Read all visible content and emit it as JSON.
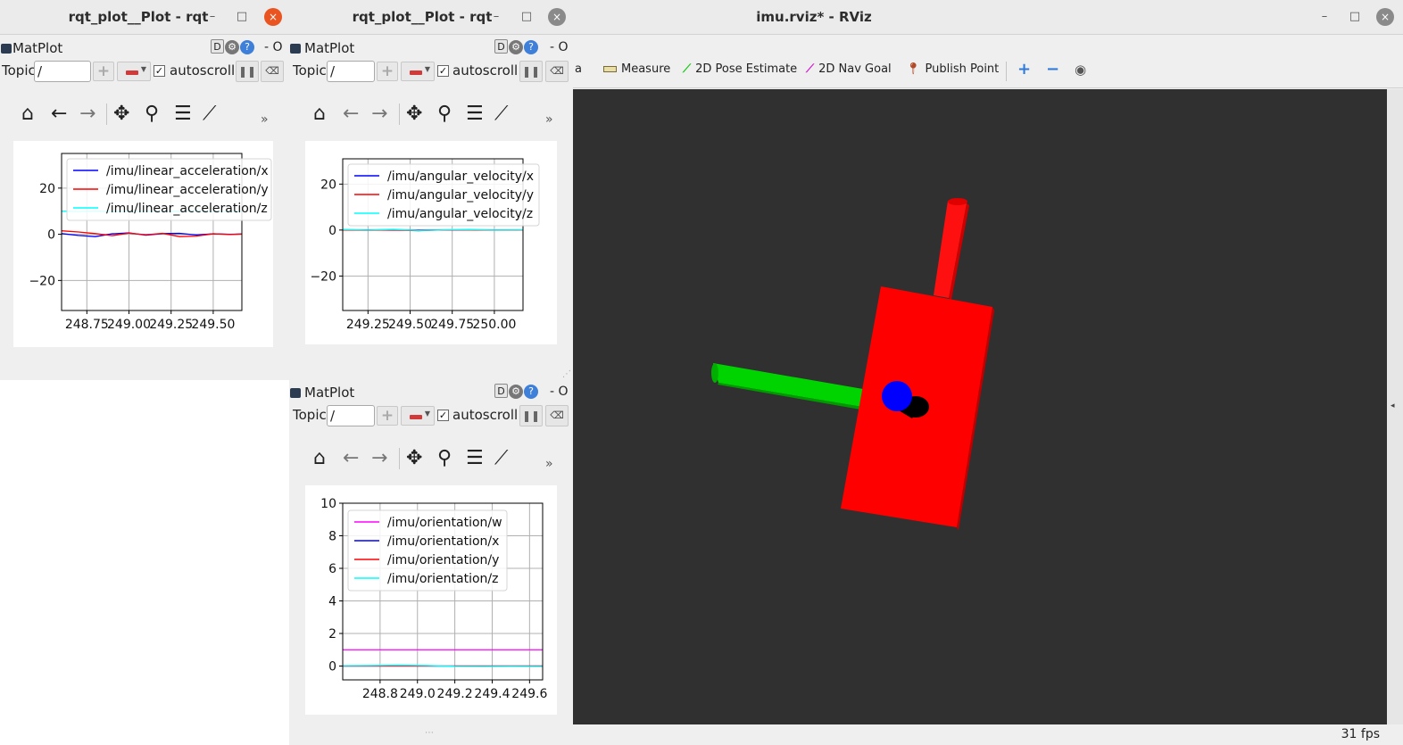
{
  "colors": {
    "titlebar": "#ebebeb",
    "close_active": "#e95420",
    "rviz_background": "#303030",
    "series_blue": "#0000ff",
    "series_red": "#ff0000",
    "series_cyan": "#00ffff",
    "series_magenta": "#ff00ff",
    "axis_x_red": "#ff0000",
    "axis_y_green": "#00cc00",
    "axis_z_blue": "#0000ff"
  },
  "window_left": {
    "title": "rqt_plot__Plot - rqt",
    "min": "–",
    "max": "□",
    "close": "×"
  },
  "window_mid": {
    "title": "rqt_plot__Plot - rqt",
    "min": "–",
    "max": "□",
    "close": "×"
  },
  "panel_common": {
    "name": "MatPlot",
    "badge_d": "D",
    "badge_g": "⚙",
    "badge_q": "?",
    "close_o": "- O",
    "topic_label": "Topic",
    "topic_value": "/",
    "add": "+",
    "check": "✓",
    "autoscroll": "autoscroll",
    "pause": "❚❚",
    "clear": "⌫",
    "more": "»"
  },
  "nav_icons": [
    "home-icon",
    "back-icon",
    "forward-icon",
    "pan-icon",
    "zoom-icon",
    "configure-icon",
    "edit-curves-icon"
  ],
  "chart_data": [
    {
      "type": "line",
      "title": "",
      "xlabel": "",
      "ylabel": "",
      "xlim": [
        248.6,
        249.67
      ],
      "ylim": [
        -33,
        35
      ],
      "xticks": [
        "248.75",
        "249.00",
        "249.25",
        "249.50"
      ],
      "yticks": [
        "20",
        "0",
        "−20"
      ],
      "xtick_values": [
        248.75,
        249.0,
        249.25,
        249.5
      ],
      "ytick_values": [
        20,
        0,
        -20
      ],
      "grid": true,
      "legend": "top-right",
      "series": [
        {
          "name": "/imu/linear_acceleration/x",
          "color": "#0000ff",
          "values": [
            0.3,
            -0.5,
            -1.0,
            0.2,
            0.6,
            -0.4,
            0.3,
            0.4,
            -0.3,
            0.2,
            0.0,
            0.1
          ]
        },
        {
          "name": "/imu/linear_acceleration/y",
          "color": "#ff0000",
          "values": [
            1.5,
            1.0,
            0.3,
            -0.6,
            0.5,
            -0.2,
            0.4,
            -1.0,
            -0.8,
            0.2,
            -0.1,
            0.1
          ]
        },
        {
          "name": "/imu/linear_acceleration/z",
          "color": "#00ffff",
          "values": [
            10.0,
            9.9,
            10.1,
            9.8,
            10.0,
            10.1,
            9.9,
            10.0,
            10.2,
            9.9,
            10.0,
            10.0
          ]
        }
      ],
      "x": [
        248.6,
        248.7,
        248.8,
        248.9,
        249.0,
        249.1,
        249.2,
        249.3,
        249.4,
        249.5,
        249.6,
        249.67
      ]
    },
    {
      "type": "line",
      "title": "",
      "xlabel": "",
      "ylabel": "",
      "xlim": [
        249.1,
        250.17
      ],
      "ylim": [
        -35,
        31
      ],
      "xticks": [
        "249.25",
        "249.50",
        "249.75",
        "250.00"
      ],
      "yticks": [
        "20",
        "0",
        "−20"
      ],
      "xtick_values": [
        249.25,
        249.5,
        249.75,
        250.0
      ],
      "ytick_values": [
        20,
        0,
        -20
      ],
      "grid": true,
      "legend": "top-right",
      "series": [
        {
          "name": "/imu/angular_velocity/x",
          "color": "#0000ff",
          "values": [
            0.0,
            0.05,
            -0.05,
            0.0,
            0.02,
            0.0,
            -0.02,
            0.0
          ]
        },
        {
          "name": "/imu/angular_velocity/y",
          "color": "#ff0000",
          "values": [
            0.0,
            -0.1,
            0.05,
            -0.3,
            0.1,
            0.0,
            -0.05,
            0.0
          ]
        },
        {
          "name": "/imu/angular_velocity/z",
          "color": "#00ffff",
          "values": [
            0.2,
            0.0,
            0.3,
            -0.2,
            0.1,
            0.2,
            0.0,
            0.1
          ]
        }
      ],
      "x": [
        249.1,
        249.25,
        249.4,
        249.55,
        249.7,
        249.85,
        250.0,
        250.17
      ]
    },
    {
      "type": "line",
      "title": "",
      "xlabel": "",
      "ylabel": "",
      "xlim": [
        248.6,
        249.67
      ],
      "ylim": [
        -0.85,
        10
      ],
      "xticks": [
        "248.8",
        "249.0",
        "249.2",
        "249.4",
        "249.6"
      ],
      "yticks": [
        "10",
        "8",
        "6",
        "4",
        "2",
        "0"
      ],
      "xtick_values": [
        248.8,
        249.0,
        249.2,
        249.4,
        249.6
      ],
      "ytick_values": [
        10,
        8,
        6,
        4,
        2,
        0
      ],
      "grid": true,
      "legend": "top-left",
      "series": [
        {
          "name": "/imu/orientation/w",
          "color": "#ff00ff",
          "values": [
            1.0,
            1.0,
            1.0,
            1.0,
            1.0,
            1.0,
            1.0,
            1.0
          ]
        },
        {
          "name": "/imu/orientation/x",
          "color": "#0000ff",
          "values": [
            0.0,
            0.0,
            0.0,
            0.0,
            0.0,
            0.0,
            0.0,
            0.0
          ]
        },
        {
          "name": "/imu/orientation/y",
          "color": "#ff0000",
          "values": [
            0.0,
            0.0,
            0.0,
            0.0,
            0.0,
            0.0,
            0.0,
            0.0
          ]
        },
        {
          "name": "/imu/orientation/z",
          "color": "#00ffff",
          "values": [
            0.02,
            0.03,
            0.05,
            0.03,
            -0.02,
            -0.03,
            -0.02,
            -0.03
          ]
        }
      ],
      "x": [
        248.6,
        248.75,
        248.9,
        249.05,
        249.2,
        249.35,
        249.5,
        249.67
      ]
    }
  ],
  "rviz": {
    "title": "imu.rviz* - RViz",
    "min": "–",
    "max": "□",
    "close": "×",
    "tool_partial": "a",
    "tools": [
      {
        "label": "Measure",
        "icon": "ruler-icon"
      },
      {
        "label": "2D Pose Estimate",
        "icon": "pose-arrow-icon"
      },
      {
        "label": "2D Nav Goal",
        "icon": "nav-goal-arrow-icon"
      },
      {
        "label": "Publish Point",
        "icon": "map-pin-icon"
      }
    ],
    "plus": "+",
    "minus": "−",
    "eye": "◉",
    "fps": "31 fps",
    "collapse": "◂"
  }
}
